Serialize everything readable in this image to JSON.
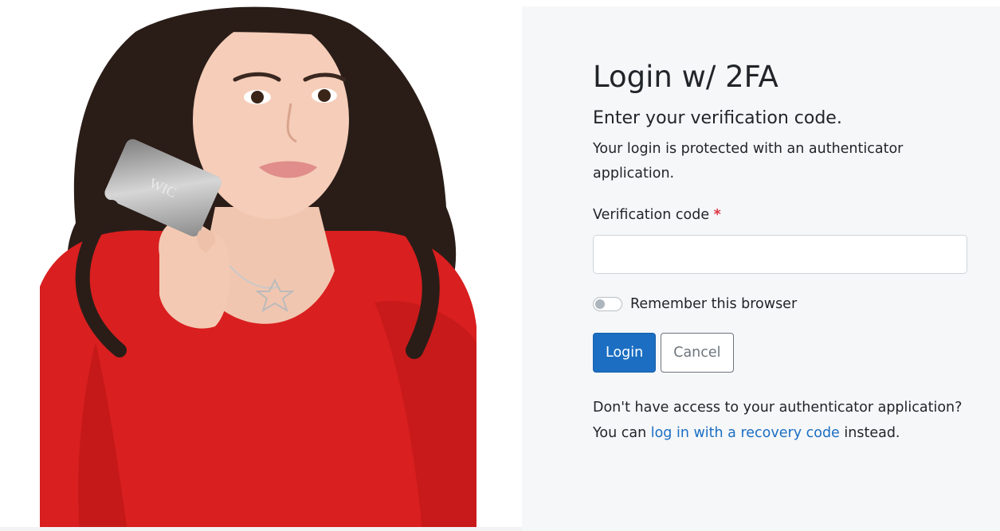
{
  "hero": {
    "card_text": "WIC"
  },
  "form": {
    "title": "Login w/ 2FA",
    "subtitle": "Enter your verification code.",
    "description": "Your login is protected with an authenticator application.",
    "code_label": "Verification code",
    "required_marker": "*",
    "code_value": "",
    "code_placeholder": "",
    "remember_label": "Remember this browser",
    "remember_checked": false,
    "login_label": "Login",
    "cancel_label": "Cancel",
    "help_prefix": "Don't have access to your authenticator application? You can ",
    "help_link": "log in with a recovery code",
    "help_suffix": " instead."
  },
  "colors": {
    "primary": "#1b6ec2",
    "required": "#dc3545",
    "panel_bg": "#f6f7f9",
    "sweater_red": "#d91f1f"
  }
}
